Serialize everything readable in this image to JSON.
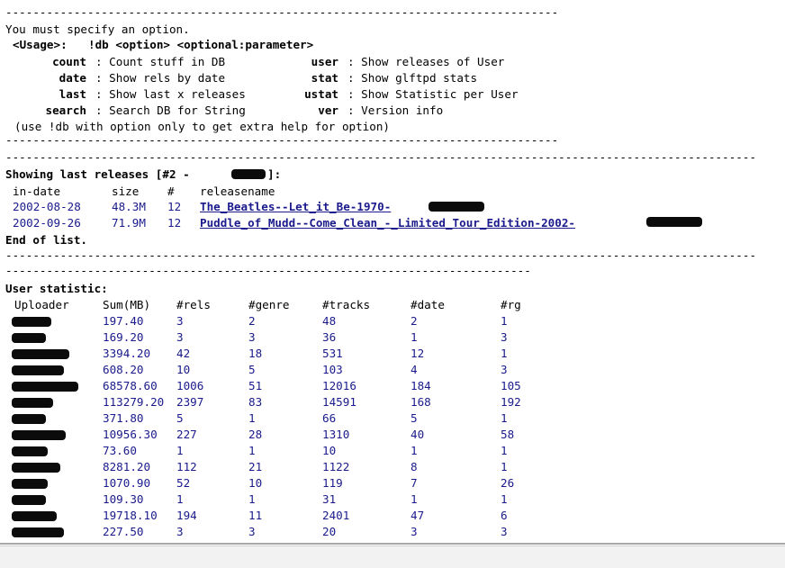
{
  "help": {
    "separator_short": "----------------------------------------------------------------------------------",
    "message": "You must specify an option.",
    "usage_label": "<Usage>:",
    "usage_cmd": "!db <option> <optional:parameter>",
    "options_left": [
      {
        "key": "count",
        "desc": ": Count stuff in DB"
      },
      {
        "key": "date",
        "desc": ": Show rels by date"
      },
      {
        "key": "last",
        "desc": ": Show last x releases"
      },
      {
        "key": "search",
        "desc": ": Search DB for String"
      }
    ],
    "options_right": [
      {
        "key": "user",
        "desc": ": Show releases of User"
      },
      {
        "key": "stat",
        "desc": ": Show glftpd stats"
      },
      {
        "key": "ustat",
        "desc": ": Show Statistic per User"
      },
      {
        "key": "ver",
        "desc": ": Version info"
      }
    ],
    "footer": "(use !db with option only to get extra help for option)"
  },
  "releases": {
    "separator_long": "------------------------------------------------------------------------------------------------------------------",
    "heading": "Showing last releases [#2 -",
    "heading_end": "]:",
    "columns": {
      "date": "in-date",
      "size": "size",
      "num": "#",
      "name": "releasename"
    },
    "rows": [
      {
        "date": "2002-08-28",
        "size": "48.3M",
        "num": "12",
        "name": "The_Beatles--Let_it_Be-1970-"
      },
      {
        "date": "2002-09-26",
        "size": "71.9M",
        "num": "12",
        "name": "Puddle_of_Mudd--Come_Clean_-_Limited_Tour_Edition-2002-"
      }
    ],
    "end": "End of list."
  },
  "stats": {
    "separator_mid": "--------------------------------------------------------------------------------",
    "heading": "User statistic:",
    "columns": [
      "Uploader",
      "Sum(MB)",
      "#rels",
      "#genre",
      "#tracks",
      "#date",
      "#rg"
    ],
    "rows": [
      [
        "197.40",
        "3",
        "2",
        "48",
        "2",
        "1"
      ],
      [
        "169.20",
        "3",
        "3",
        "36",
        "1",
        "3"
      ],
      [
        "3394.20",
        "42",
        "18",
        "531",
        "12",
        "1"
      ],
      [
        "608.20",
        "10",
        "5",
        "103",
        "4",
        "3"
      ],
      [
        "68578.60",
        "1006",
        "51",
        "12016",
        "184",
        "105"
      ],
      [
        "113279.20",
        "2397",
        "83",
        "14591",
        "168",
        "192"
      ],
      [
        "371.80",
        "5",
        "1",
        "66",
        "5",
        "1"
      ],
      [
        "10956.30",
        "227",
        "28",
        "1310",
        "40",
        "58"
      ],
      [
        "73.60",
        "1",
        "1",
        "10",
        "1",
        "1"
      ],
      [
        "8281.20",
        "112",
        "21",
        "1122",
        "8",
        "1"
      ],
      [
        "1070.90",
        "52",
        "10",
        "119",
        "7",
        "26"
      ],
      [
        "109.30",
        "1",
        "1",
        "31",
        "1",
        "1"
      ],
      [
        "19718.10",
        "194",
        "11",
        "2401",
        "47",
        "6"
      ],
      [
        "227.50",
        "3",
        "3",
        "20",
        "3",
        "3"
      ]
    ]
  }
}
